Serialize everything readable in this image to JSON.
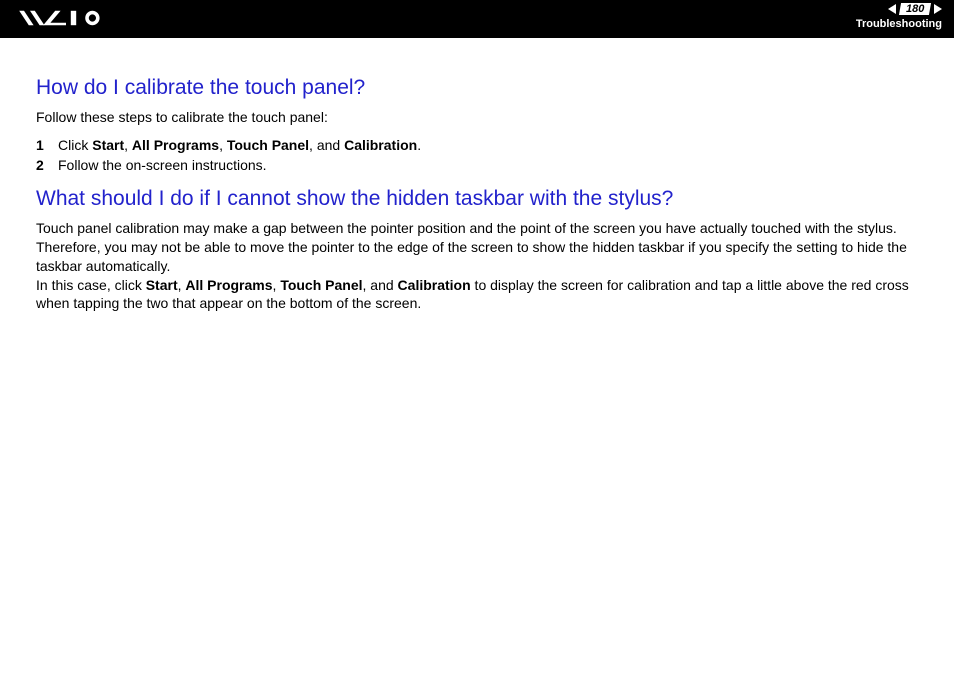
{
  "header": {
    "page_number": "180",
    "section": "Troubleshooting"
  },
  "section1": {
    "heading": "How do I calibrate the touch panel?",
    "intro": "Follow these steps to calibrate the touch panel:",
    "steps": [
      {
        "num": "1",
        "pre": "Click ",
        "b1": "Start",
        "s1": ", ",
        "b2": "All Programs",
        "s2": ", ",
        "b3": "Touch Panel",
        "s3": ", and ",
        "b4": "Calibration",
        "post": "."
      },
      {
        "num": "2",
        "plain": "Follow the on-screen instructions."
      }
    ]
  },
  "section2": {
    "heading": "What should I do if I cannot show the hidden taskbar with the stylus?",
    "para1": "Touch panel calibration may make a gap between the pointer position and the point of the screen you have actually touched with the stylus. Therefore, you may not be able to move the pointer to the edge of the screen to show the hidden taskbar if you specify the setting to hide the taskbar automatically.",
    "para2_pre": "In this case, click ",
    "b1": "Start",
    "s1": ", ",
    "b2": "All Programs",
    "s2": ", ",
    "b3": "Touch Panel",
    "s3": ", and ",
    "b4": "Calibration",
    "para2_post": " to display the screen for calibration and tap a little above the red cross when tapping the two that appear on the bottom of the screen."
  }
}
